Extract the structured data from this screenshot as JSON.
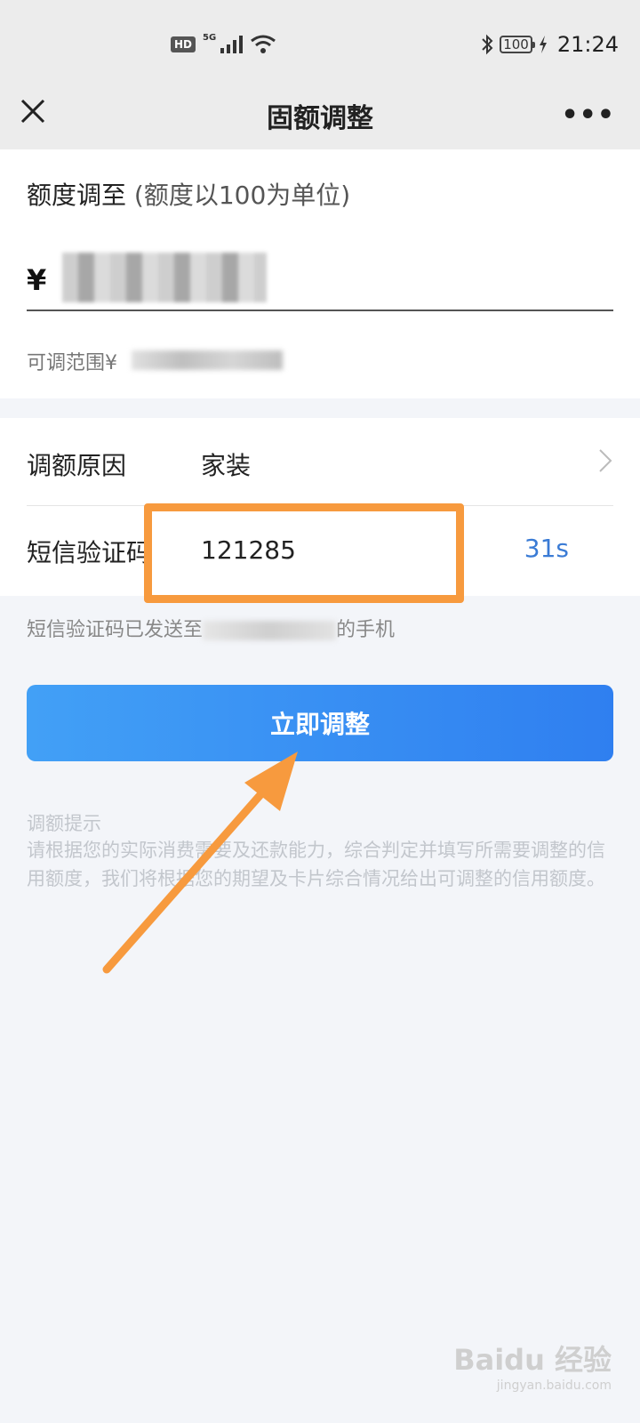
{
  "status_bar": {
    "hd": "HD",
    "network": "5G",
    "battery": "100",
    "time": "21:24"
  },
  "nav": {
    "title": "固额调整",
    "more": "•••"
  },
  "amount": {
    "label": "额度调至",
    "hint": "(额度以100为单位)",
    "currency": "¥",
    "range_label": "可调范围¥"
  },
  "form": {
    "reason_label": "调额原因",
    "reason_value": "家装",
    "sms_label": "短信验证码",
    "sms_value": "121285",
    "countdown": "31s"
  },
  "sms_tip": {
    "prefix": "短信验证码已发送至",
    "suffix": "的手机"
  },
  "submit_label": "立即调整",
  "tips": {
    "title": "调额提示",
    "body": "请根据您的实际消费需要及还款能力，综合判定并填写所需要调整的信用额度，我们将根据您的期望及卡片综合情况给出可调整的信用额度。"
  },
  "watermark": {
    "brand": "Baidu 经验",
    "url": "jingyan.baidu.com"
  },
  "colors": {
    "accent": "#3a7bd5",
    "highlight": "#f79a3e",
    "button_start": "#42a0f6",
    "button_end": "#2f7ff0"
  }
}
